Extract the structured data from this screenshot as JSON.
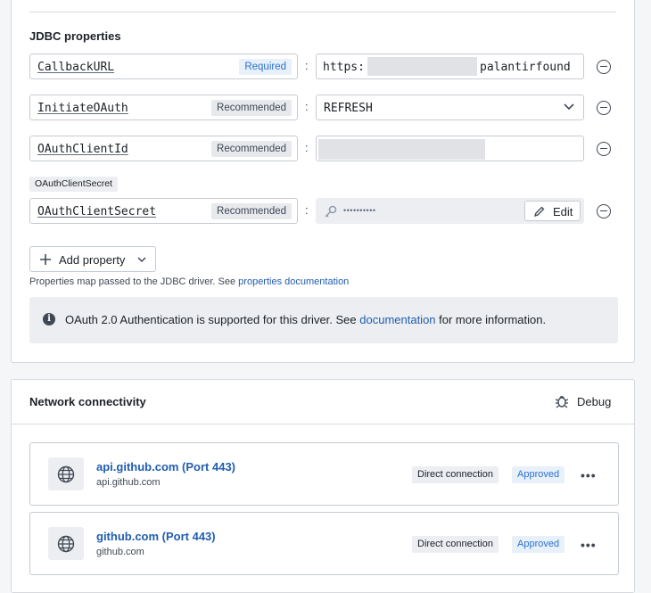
{
  "jdbc": {
    "title": "JDBC properties",
    "properties": [
      {
        "key": "CallbackURL",
        "tag": "Required",
        "value_prefix": "https:",
        "value_suffix": "palantirfound"
      },
      {
        "key": "InitiateOAuth",
        "tag": "Recommended",
        "value": "REFRESH"
      },
      {
        "key": "OAuthClientId",
        "tag": "Recommended",
        "value": ""
      },
      {
        "key": "OAuthClientSecret",
        "tag": "Recommended",
        "value": "••••••••••",
        "edit_label": "Edit"
      }
    ],
    "secret_label": "OAuthClientSecret",
    "add_property_label": "Add property",
    "hint_text": "Properties map passed to the JDBC driver. See ",
    "hint_link": "properties documentation",
    "callout_prefix": "OAuth 2.0 Authentication is supported for this driver. See ",
    "callout_link": "documentation",
    "callout_suffix": " for more information."
  },
  "network": {
    "title": "Network connectivity",
    "debug_label": "Debug",
    "items": [
      {
        "title": "api.github.com (Port 443)",
        "host": "api.github.com",
        "connection": "Direct connection",
        "status": "Approved"
      },
      {
        "title": "github.com (Port 443)",
        "host": "github.com",
        "connection": "Direct connection",
        "status": "Approved"
      }
    ]
  },
  "colors": {
    "accent": "#215db0",
    "approved": "#2d72d2"
  }
}
